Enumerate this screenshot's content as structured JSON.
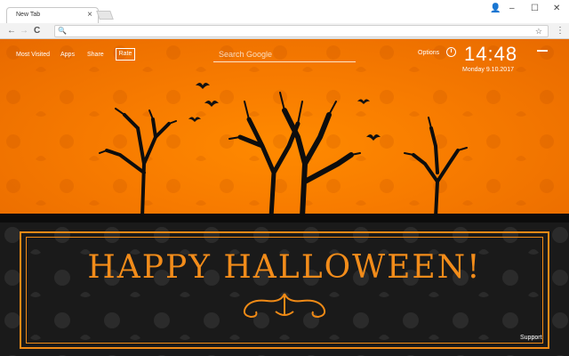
{
  "browser": {
    "tab_title": "New Tab",
    "tab_close": "×",
    "window_controls": {
      "account": "👤",
      "minimize": "–",
      "maximize": "☐",
      "close": "✕"
    },
    "nav": {
      "back": "←",
      "forward": "→",
      "reload": "C"
    },
    "omnibox_placeholder": "",
    "star": "☆",
    "menu": "⋮"
  },
  "page": {
    "nav_items": [
      "Most Visited",
      "Apps",
      "Share"
    ],
    "rate_label": "Rate",
    "search_placeholder": "Search Google",
    "options_label": "Options",
    "time": "14:48",
    "date": "Monday  9.10.2017",
    "flag_text": "▬▬",
    "headline": "HAPPY HALLOWEEN!",
    "support_label": "Support"
  },
  "colors": {
    "orange": "#f77b00",
    "accent": "#f08a16",
    "dark": "#1a1a1a"
  }
}
